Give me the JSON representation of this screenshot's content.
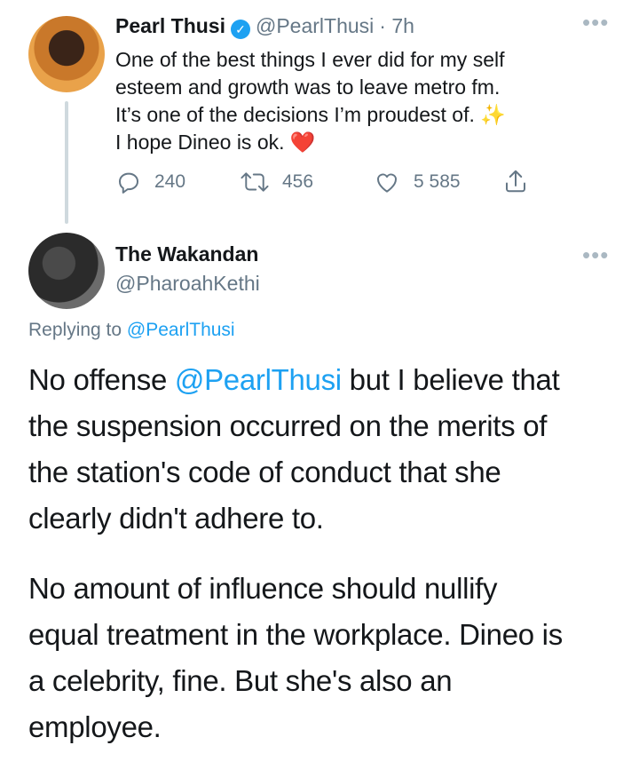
{
  "tweet": {
    "author_name": "Pearl Thusi",
    "handle": "@PearlThusi",
    "time": "· 7h",
    "lines": [
      "One of the best things I ever did for my self",
      "esteem and growth was to leave metro fm.",
      "It’s one of the decisions I’m proudest of. ✨",
      "I hope Dineo is ok. ❤️"
    ],
    "replies": "240",
    "retweets": "456",
    "likes": "5 585"
  },
  "reply": {
    "author_name": "The Wakandan",
    "handle": "@PharoahKethi",
    "replying_prefix": "Replying to",
    "replying_to": "@PearlThusi",
    "p1_before": "No offense ",
    "p1_mention": "@PearlThusi",
    "p1_after": " but I believe that",
    "p1_lines": [
      "the suspension occurred on the merits of",
      "the station's code of conduct that she",
      "clearly didn't adhere to."
    ],
    "p2_lines": [
      "No amount of influence should nullify",
      "equal treatment in the workplace. Dineo is",
      "a celebrity, fine. But she's also an",
      "employee."
    ]
  },
  "icons": {
    "more": "more-options-icon",
    "verified": "verified-badge-icon",
    "reply": "reply-icon",
    "retweet": "retweet-icon",
    "like": "like-icon",
    "share": "share-icon"
  },
  "colors": {
    "accent": "#1da1f2",
    "muted": "#657786",
    "text": "#14171a"
  }
}
